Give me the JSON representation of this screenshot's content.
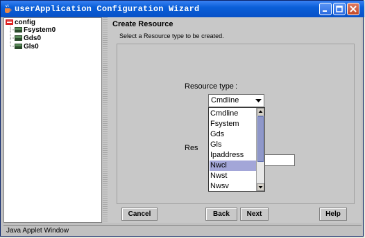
{
  "window": {
    "title": "userApplication Configuration Wizard"
  },
  "tree": {
    "root": "config",
    "children": [
      "Fsystem0",
      "Gds0",
      "Gls0"
    ]
  },
  "panel": {
    "heading": "Create Resource",
    "subtext": "Select a Resource type to be created.",
    "resource_type_label": "Resource type",
    "resource_type_colon": ":",
    "resource_type_value": "Cmdline",
    "name_label_partial": "Res",
    "name_value": ""
  },
  "dropdown": {
    "options": [
      "Cmdline",
      "Fsystem",
      "Gds",
      "Gls",
      "Ipaddress",
      "Nwcl",
      "Nwst",
      "Nwsv"
    ],
    "highlighted": "Nwcl"
  },
  "buttons": {
    "cancel": "Cancel",
    "back": "Back",
    "next": "Next",
    "help": "Help"
  },
  "status": {
    "text": "Java Applet Window"
  },
  "colors": {
    "titlebar": "#0a5fd8",
    "selection": "#a3a6d8",
    "scroll_thumb": "#8f97c9"
  }
}
